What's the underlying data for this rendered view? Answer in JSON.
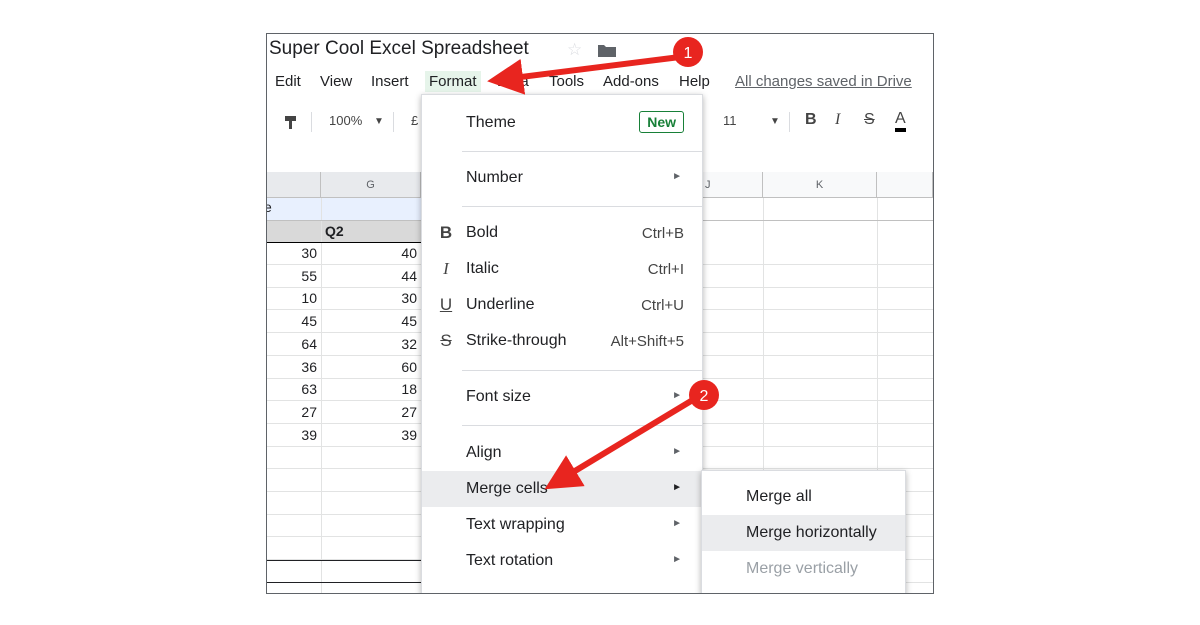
{
  "doc": {
    "title": "Super Cool Excel Spreadsheet",
    "saved_status": "All changes saved in Drive"
  },
  "menubar": [
    "Edit",
    "View",
    "Insert",
    "Format",
    "Data",
    "Tools",
    "Add-ons",
    "Help"
  ],
  "toolbar": {
    "zoom": "100%",
    "currency": "£",
    "font_size": "11",
    "bold": "B",
    "italic": "I",
    "strike": "S",
    "text_color": "A"
  },
  "grid": {
    "columns": [
      "G",
      "J",
      "K"
    ],
    "header_row": {
      "q2": "Q2"
    },
    "left_col_values": [
      "30",
      "55",
      "10",
      "45",
      "64",
      "36",
      "63",
      "27",
      "39"
    ],
    "q2_values": [
      "40",
      "44",
      "30",
      "45",
      "32",
      "60",
      "18",
      "27",
      "39"
    ],
    "cut_text": "e"
  },
  "format_menu": {
    "theme": "Theme",
    "new_badge": "New",
    "number": "Number",
    "bold": "Bold",
    "bold_shortcut": "Ctrl+B",
    "bold_icon": "B",
    "italic": "Italic",
    "italic_shortcut": "Ctrl+I",
    "italic_icon": "I",
    "underline": "Underline",
    "underline_shortcut": "Ctrl+U",
    "underline_icon": "U",
    "strike": "Strike-through",
    "strike_shortcut": "Alt+Shift+5",
    "strike_icon": "S",
    "font_size": "Font size",
    "align": "Align",
    "merge_cells": "Merge cells",
    "text_wrapping": "Text wrapping",
    "text_rotation": "Text rotation"
  },
  "merge_submenu": {
    "merge_all": "Merge all",
    "merge_horizontally": "Merge horizontally",
    "merge_vertically": "Merge vertically"
  },
  "annotations": {
    "step1": "1",
    "step2": "2",
    "arrow_color": "#e8251f"
  },
  "colors": {
    "accent_green": "#188038",
    "menu_highlight": "#ebecee"
  }
}
